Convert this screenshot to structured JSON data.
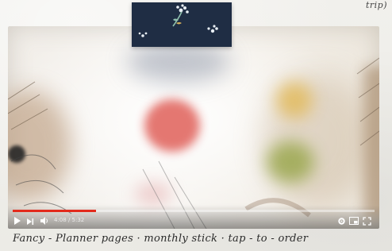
{
  "corner_note": "trip)",
  "video": {
    "time_text": "4:08 / 5:32",
    "progress_fraction": 0.23,
    "colors": {
      "progress": "#e32a1c",
      "controls": "#ffffff"
    },
    "controls": {
      "play": "play-icon",
      "next": "next-icon",
      "volume": "volume-icon",
      "settings": "gear-icon",
      "miniplayer": "miniplayer-icon",
      "fullscreen": "fullscreen-icon"
    }
  },
  "caption": "Fancy - Planner pages · monthly stick · tap - to - order"
}
